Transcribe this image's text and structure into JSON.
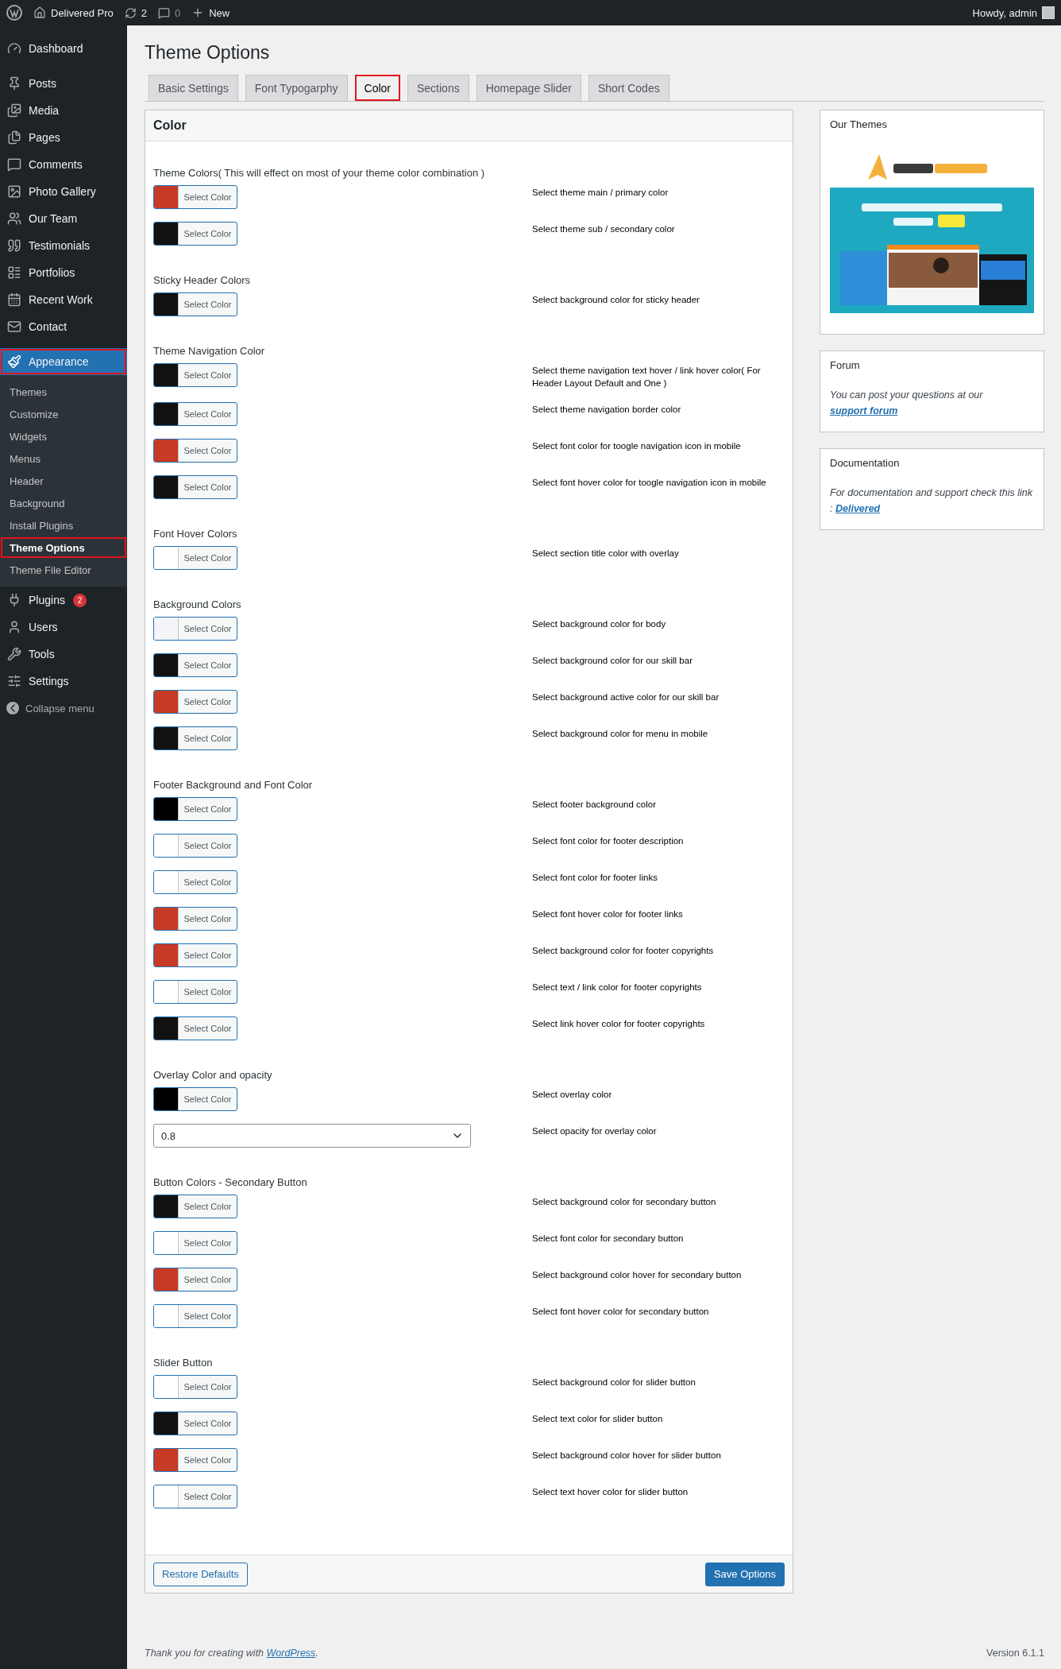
{
  "admin_bar": {
    "site_name": "Delivered Pro",
    "updates": "2",
    "comments": "0",
    "new_label": "New",
    "greeting": "Howdy, admin"
  },
  "sidebar": {
    "items": [
      {
        "label": "Dashboard",
        "selected": false
      },
      {
        "label": "Posts",
        "selected": false
      },
      {
        "label": "Media",
        "selected": false
      },
      {
        "label": "Pages",
        "selected": false
      },
      {
        "label": "Comments",
        "selected": false
      },
      {
        "label": "Photo Gallery",
        "selected": false
      },
      {
        "label": "Our Team",
        "selected": false
      },
      {
        "label": "Testimonials",
        "selected": false
      },
      {
        "label": "Portfolios",
        "selected": false
      },
      {
        "label": "Recent Work",
        "selected": false
      },
      {
        "label": "Contact",
        "selected": false
      },
      {
        "label": "Appearance",
        "selected": true,
        "children": [
          {
            "label": "Themes",
            "selected": false
          },
          {
            "label": "Customize",
            "selected": false
          },
          {
            "label": "Widgets",
            "selected": false
          },
          {
            "label": "Menus",
            "selected": false
          },
          {
            "label": "Header",
            "selected": false
          },
          {
            "label": "Background",
            "selected": false
          },
          {
            "label": "Install Plugins",
            "selected": false
          },
          {
            "label": "Theme Options",
            "selected": true
          },
          {
            "label": "Theme File Editor",
            "selected": false
          }
        ]
      },
      {
        "label": "Plugins",
        "selected": false,
        "badge": "2"
      },
      {
        "label": "Users",
        "selected": false
      },
      {
        "label": "Tools",
        "selected": false
      },
      {
        "label": "Settings",
        "selected": false
      }
    ],
    "collapse_label": "Collapse menu"
  },
  "page_title": "Theme Options",
  "tabs": [
    {
      "label": "Basic Settings",
      "selected": false
    },
    {
      "label": "Font Typogarphy",
      "selected": false
    },
    {
      "label": "Color",
      "selected": true
    },
    {
      "label": "Sections",
      "selected": false
    },
    {
      "label": "Homepage Slider",
      "selected": false
    },
    {
      "label": "Short Codes",
      "selected": false
    }
  ],
  "panel": {
    "title": "Color",
    "groups": [
      {
        "heading": "Theme Colors( This will effect on most of your theme color combination )",
        "rows": [
          {
            "kind": "color",
            "color": "#c63a26",
            "button": "Select Color",
            "description": "Select theme main / primary color"
          },
          {
            "kind": "color",
            "color": "#111111",
            "button": "Select Color",
            "description": "Select theme sub / secondary color"
          }
        ]
      },
      {
        "heading": "Sticky Header Colors",
        "rows": [
          {
            "kind": "color",
            "color": "#111111",
            "button": "Select Color",
            "description": "Select background color for sticky header"
          }
        ]
      },
      {
        "heading": "Theme Navigation Color",
        "rows": [
          {
            "kind": "color",
            "color": "#111111",
            "button": "Select Color",
            "description": "Select theme navigation text hover / link hover color( For Header Layout Default and One )"
          },
          {
            "kind": "color",
            "color": "#111111",
            "button": "Select Color",
            "description": "Select theme navigation border color"
          },
          {
            "kind": "color",
            "color": "#c63a26",
            "button": "Select Color",
            "description": "Select font color for toogle navigation icon in mobile"
          },
          {
            "kind": "color",
            "color": "#111111",
            "button": "Select Color",
            "description": "Select font hover color for toogle navigation icon in mobile"
          }
        ]
      },
      {
        "heading": "Font Hover Colors",
        "rows": [
          {
            "kind": "color",
            "color": "#ffffff",
            "button": "Select Color",
            "description": "Select section title color with overlay"
          }
        ]
      },
      {
        "heading": "Background Colors",
        "rows": [
          {
            "kind": "color",
            "color": "#f4f5f9",
            "button": "Select Color",
            "description": "Select background color for body"
          },
          {
            "kind": "color",
            "color": "#111111",
            "button": "Select Color",
            "description": "Select background color for our skill bar"
          },
          {
            "kind": "color",
            "color": "#c63a26",
            "button": "Select Color",
            "description": "Select background active color for our skill bar"
          },
          {
            "kind": "color",
            "color": "#111111",
            "button": "Select Color",
            "description": "Select background color for menu in mobile"
          }
        ]
      },
      {
        "heading": "Footer Background and Font Color",
        "rows": [
          {
            "kind": "color",
            "color": "#000000",
            "button": "Select Color",
            "description": "Select footer background color"
          },
          {
            "kind": "color",
            "color": "#ffffff",
            "button": "Select Color",
            "description": "Select font color for footer description"
          },
          {
            "kind": "color",
            "color": "#ffffff",
            "button": "Select Color",
            "description": "Select font color for footer links"
          },
          {
            "kind": "color",
            "color": "#c63a26",
            "button": "Select Color",
            "description": "Select font hover color for footer links"
          },
          {
            "kind": "color",
            "color": "#c63a26",
            "button": "Select Color",
            "description": "Select background color for footer copyrights"
          },
          {
            "kind": "color",
            "color": "#ffffff",
            "button": "Select Color",
            "description": "Select text / link color for footer copyrights"
          },
          {
            "kind": "color",
            "color": "#111111",
            "button": "Select Color",
            "description": "Select link hover color for footer copyrights"
          }
        ]
      },
      {
        "heading": "Overlay Color and opacity",
        "rows": [
          {
            "kind": "color",
            "color": "#000000",
            "button": "Select Color",
            "description": "Select overlay color"
          },
          {
            "kind": "select",
            "value": "0.8",
            "description": "Select opacity for overlay color"
          }
        ]
      },
      {
        "heading": "Button Colors - Secondary Button",
        "rows": [
          {
            "kind": "color",
            "color": "#111111",
            "button": "Select Color",
            "description": "Select background color for secondary button"
          },
          {
            "kind": "color",
            "color": "#ffffff",
            "button": "Select Color",
            "description": "Select font color for secondary button"
          },
          {
            "kind": "color",
            "color": "#c63a26",
            "button": "Select Color",
            "description": "Select background color hover for secondary button"
          },
          {
            "kind": "color",
            "color": "#ffffff",
            "button": "Select Color",
            "description": "Select font hover color for secondary button"
          }
        ]
      },
      {
        "heading": "Slider Button",
        "rows": [
          {
            "kind": "color",
            "color": "#ffffff",
            "button": "Select Color",
            "description": "Select background color for slider button"
          },
          {
            "kind": "color",
            "color": "#111111",
            "button": "Select Color",
            "description": "Select text color for slider button"
          },
          {
            "kind": "color",
            "color": "#c63a26",
            "button": "Select Color",
            "description": "Select background color hover for slider button"
          },
          {
            "kind": "color",
            "color": "#ffffff",
            "button": "Select Color",
            "description": "Select text hover color for slider button"
          }
        ]
      }
    ],
    "restore_button": "Restore Defaults",
    "save_button": "Save Options"
  },
  "widgets": [
    {
      "title": "Our Themes",
      "kind": "picture"
    },
    {
      "title": "Forum",
      "kind": "text",
      "text": "You can post your questions at our ",
      "link": "support forum"
    },
    {
      "title": "Documentation",
      "kind": "text",
      "text": "For documentation and support check this link : ",
      "link": "Delivered"
    }
  ],
  "footer": {
    "text": "Thank you for creating with ",
    "link": "WordPress",
    "end": ".",
    "version": "Version 6.1.1"
  }
}
